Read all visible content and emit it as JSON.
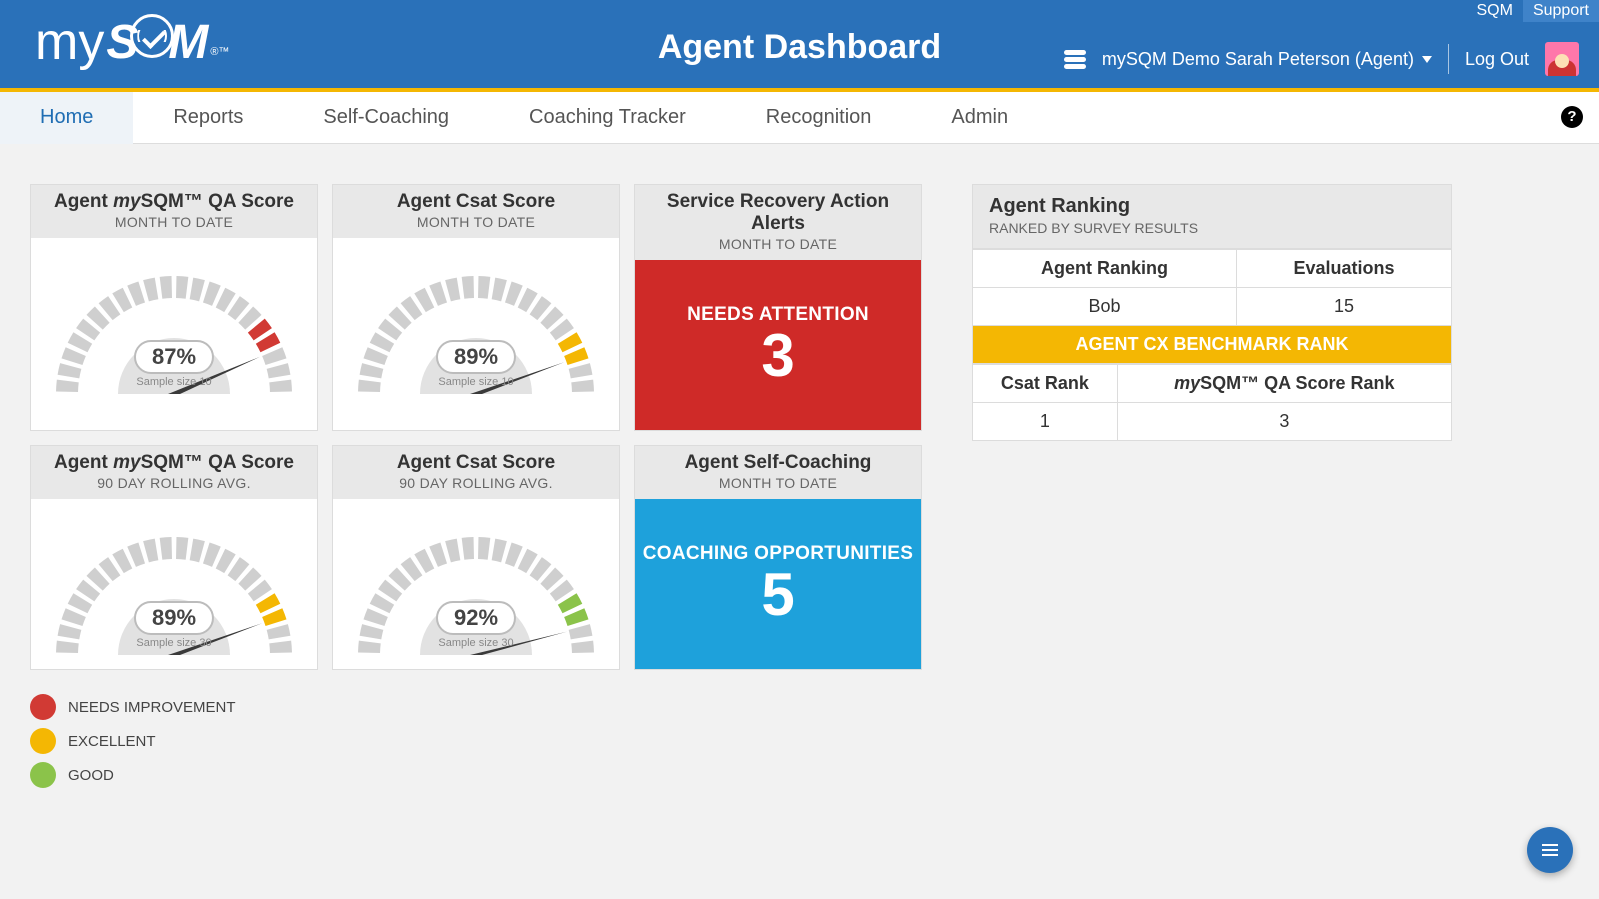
{
  "top_links": {
    "sqm": "SQM",
    "support": "Support"
  },
  "logo": {
    "prefix": "my",
    "main": "SQM",
    "suffix": "®™"
  },
  "page_title": "Agent Dashboard",
  "user": {
    "label": "mySQM Demo Sarah Peterson (Agent)"
  },
  "logout": "Log Out",
  "nav": {
    "home": "Home",
    "reports": "Reports",
    "self_coaching": "Self-Coaching",
    "coaching_tracker": "Coaching Tracker",
    "recognition": "Recognition",
    "admin": "Admin"
  },
  "cards": {
    "qa_mtd": {
      "title_pre": "Agent ",
      "title_it": "my",
      "title_post": "SQM™ QA Score",
      "sub": "MONTH TO DATE",
      "value": "87%",
      "sample": "Sample size 10",
      "pct": 87,
      "color": "#d13a34"
    },
    "csat_mtd": {
      "title": "Agent Csat Score",
      "sub": "MONTH TO DATE",
      "value": "89%",
      "sample": "Sample size 10",
      "pct": 89,
      "color": "#f4b703"
    },
    "alerts": {
      "title": "Service Recovery Action Alerts",
      "sub": "MONTH TO DATE",
      "label": "NEEDS ATTENTION",
      "num": "3"
    },
    "qa_90": {
      "title_pre": "Agent ",
      "title_it": "my",
      "title_post": "SQM™ QA Score",
      "sub": "90 DAY ROLLING AVG.",
      "value": "89%",
      "sample": "Sample size 30",
      "pct": 89,
      "color": "#f4b703"
    },
    "csat_90": {
      "title": "Agent Csat Score",
      "sub": "90 DAY ROLLING AVG.",
      "value": "92%",
      "sample": "Sample size 30",
      "pct": 92,
      "color": "#8bc34a"
    },
    "self": {
      "title": "Agent Self-Coaching",
      "sub": "MONTH TO DATE",
      "label": "COACHING OPPORTUNITIES",
      "num": "5"
    }
  },
  "legend": {
    "needs": "NEEDS IMPROVEMENT",
    "excellent": "EXCELLENT",
    "good": "GOOD"
  },
  "ranking": {
    "title": "Agent Ranking",
    "sub": "RANKED BY SURVEY RESULTS",
    "h1": "Agent Ranking",
    "h2": "Evaluations",
    "r1c1": "Bob",
    "r1c2": "15",
    "banner": "AGENT CX BENCHMARK RANK",
    "h3": "Csat Rank",
    "h4_pre": "my",
    "h4_post": "SQM™ QA Score Rank",
    "r2c1": "1",
    "r2c2": "3"
  },
  "chart_data": [
    {
      "type": "gauge",
      "name": "Agent mySQM QA Score MTD",
      "value": 87,
      "range": [
        0,
        100
      ],
      "segments": [
        {
          "name": "needs",
          "color": "#d13a34"
        }
      ],
      "sample_size": 10
    },
    {
      "type": "gauge",
      "name": "Agent Csat Score MTD",
      "value": 89,
      "range": [
        0,
        100
      ],
      "segments": [
        {
          "name": "excellent",
          "color": "#f4b703"
        }
      ],
      "sample_size": 10
    },
    {
      "type": "gauge",
      "name": "Agent mySQM QA Score 90day",
      "value": 89,
      "range": [
        0,
        100
      ],
      "segments": [
        {
          "name": "excellent",
          "color": "#f4b703"
        }
      ],
      "sample_size": 30
    },
    {
      "type": "gauge",
      "name": "Agent Csat Score 90day",
      "value": 92,
      "range": [
        0,
        100
      ],
      "segments": [
        {
          "name": "good",
          "color": "#8bc34a"
        }
      ],
      "sample_size": 30
    }
  ]
}
